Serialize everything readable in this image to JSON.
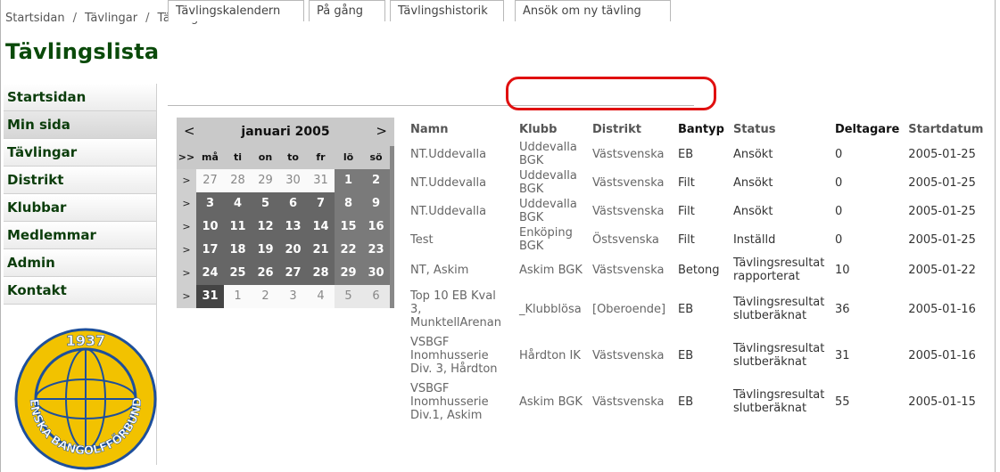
{
  "breadcrumb": [
    "Startsidan",
    "Tävlingar",
    "Tävlingskalendern"
  ],
  "breadcrumb_separator": "/",
  "page_title": "Tävlingslista",
  "sidebar": {
    "items": [
      {
        "label": "Startsidan",
        "active": false
      },
      {
        "label": "Min sida",
        "active": true
      },
      {
        "label": "Tävlingar",
        "active": false
      },
      {
        "label": "Distrikt",
        "active": false
      },
      {
        "label": "Klubbar",
        "active": false
      },
      {
        "label": "Medlemmar",
        "active": false
      },
      {
        "label": "Admin",
        "active": false
      },
      {
        "label": "Kontakt",
        "active": false
      }
    ],
    "logo_year": "1937",
    "logo_text": "SVENSKA BANGOLFFÖRBUNDET"
  },
  "tabs": [
    {
      "label": "Tävlingskalendern"
    },
    {
      "label": "På gång"
    },
    {
      "label": "Tävlingshistorik"
    },
    {
      "label": "Ansök om ny tävling"
    }
  ],
  "calendar": {
    "month_label": "januari 2005",
    "prev": "<",
    "next": ">",
    "week_header": ">>",
    "weekdays": [
      "må",
      "ti",
      "on",
      "to",
      "fr",
      "lö",
      "sö"
    ],
    "week_marker": ">",
    "weeks": [
      [
        {
          "d": "27",
          "t": "out"
        },
        {
          "d": "28",
          "t": "out"
        },
        {
          "d": "29",
          "t": "out"
        },
        {
          "d": "30",
          "t": "out"
        },
        {
          "d": "31",
          "t": "out"
        },
        {
          "d": "1",
          "t": "wkend"
        },
        {
          "d": "2",
          "t": "wkend"
        }
      ],
      [
        {
          "d": "3",
          "t": "day"
        },
        {
          "d": "4",
          "t": "day"
        },
        {
          "d": "5",
          "t": "day"
        },
        {
          "d": "6",
          "t": "day"
        },
        {
          "d": "7",
          "t": "day"
        },
        {
          "d": "8",
          "t": "wkend"
        },
        {
          "d": "9",
          "t": "wkend"
        }
      ],
      [
        {
          "d": "10",
          "t": "day"
        },
        {
          "d": "11",
          "t": "day"
        },
        {
          "d": "12",
          "t": "day"
        },
        {
          "d": "13",
          "t": "day"
        },
        {
          "d": "14",
          "t": "day"
        },
        {
          "d": "15",
          "t": "wkend"
        },
        {
          "d": "16",
          "t": "wkend"
        }
      ],
      [
        {
          "d": "17",
          "t": "day"
        },
        {
          "d": "18",
          "t": "day"
        },
        {
          "d": "19",
          "t": "day"
        },
        {
          "d": "20",
          "t": "day"
        },
        {
          "d": "21",
          "t": "day"
        },
        {
          "d": "22",
          "t": "wkend"
        },
        {
          "d": "23",
          "t": "wkend"
        }
      ],
      [
        {
          "d": "24",
          "t": "day"
        },
        {
          "d": "25",
          "t": "day"
        },
        {
          "d": "26",
          "t": "day"
        },
        {
          "d": "27",
          "t": "day"
        },
        {
          "d": "28",
          "t": "day"
        },
        {
          "d": "29",
          "t": "wkend"
        },
        {
          "d": "30",
          "t": "wkend"
        }
      ],
      [
        {
          "d": "31",
          "t": "sel"
        },
        {
          "d": "1",
          "t": "out"
        },
        {
          "d": "2",
          "t": "out"
        },
        {
          "d": "3",
          "t": "out"
        },
        {
          "d": "4",
          "t": "out"
        },
        {
          "d": "5",
          "t": "outw"
        },
        {
          "d": "6",
          "t": "outw"
        }
      ]
    ]
  },
  "table": {
    "columns": [
      "Namn",
      "Klubb",
      "Distrikt",
      "Bantyp",
      "Status",
      "Deltagare",
      "Startdatum"
    ],
    "rows": [
      [
        "NT.Uddevalla",
        "Uddevalla BGK",
        "Västsvenska",
        "EB",
        "Ansökt",
        "0",
        "2005-01-25"
      ],
      [
        "NT.Uddevalla",
        "Uddevalla BGK",
        "Västsvenska",
        "Filt",
        "Ansökt",
        "0",
        "2005-01-25"
      ],
      [
        "NT.Uddevalla",
        "Uddevalla BGK",
        "Västsvenska",
        "Filt",
        "Ansökt",
        "0",
        "2005-01-25"
      ],
      [
        "Test",
        "Enköping BGK",
        "Östsvenska",
        "Filt",
        "Inställd",
        "0",
        "2005-01-25"
      ],
      [
        "NT, Askim",
        "Askim BGK",
        "Västsvenska",
        "Betong",
        "Tävlingsresultat rapporterat",
        "10",
        "2005-01-22"
      ],
      [
        "Top 10 EB Kval 3, MunktellArenan",
        "_Klubblösa",
        "[Oberoende]",
        "EB",
        "Tävlingsresultat slutberäknat",
        "36",
        "2005-01-16"
      ],
      [
        "VSBGF Inomhusserie Div. 3, Hårdton",
        "Hårdton IK",
        "Västsvenska",
        "EB",
        "Tävlingsresultat slutberäknat",
        "31",
        "2005-01-16"
      ],
      [
        "VSBGF Inomhusserie Div.1, Askim",
        "Askim BGK",
        "Västsvenska",
        "EB",
        "Tävlingsresultat slutberäknat",
        "55",
        "2005-01-15"
      ]
    ]
  },
  "colors": {
    "title_green": "#0a4a0a",
    "highlight_red": "#e01010",
    "logo_yellow": "#f2c200",
    "logo_blue": "#1d4f9c"
  }
}
